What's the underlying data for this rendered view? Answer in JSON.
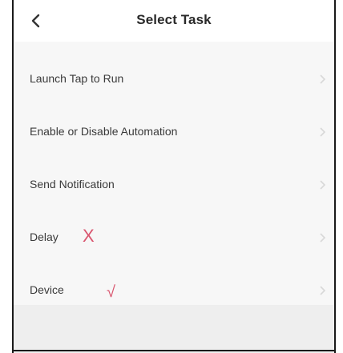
{
  "header": {
    "title": "Select Task"
  },
  "icons": {
    "back": "chevron-left-icon",
    "row_chevron": "chevron-right-icon"
  },
  "list": {
    "items": [
      {
        "label": "Launch Tap to Run"
      },
      {
        "label": "Enable or Disable Automation"
      },
      {
        "label": "Send Notification"
      },
      {
        "label": "Delay",
        "mark": "X"
      },
      {
        "label": "Device",
        "mark": "√"
      }
    ]
  },
  "colors": {
    "mark": "#d9566f",
    "background": "#f7f7f7",
    "header": "#ffffff"
  }
}
